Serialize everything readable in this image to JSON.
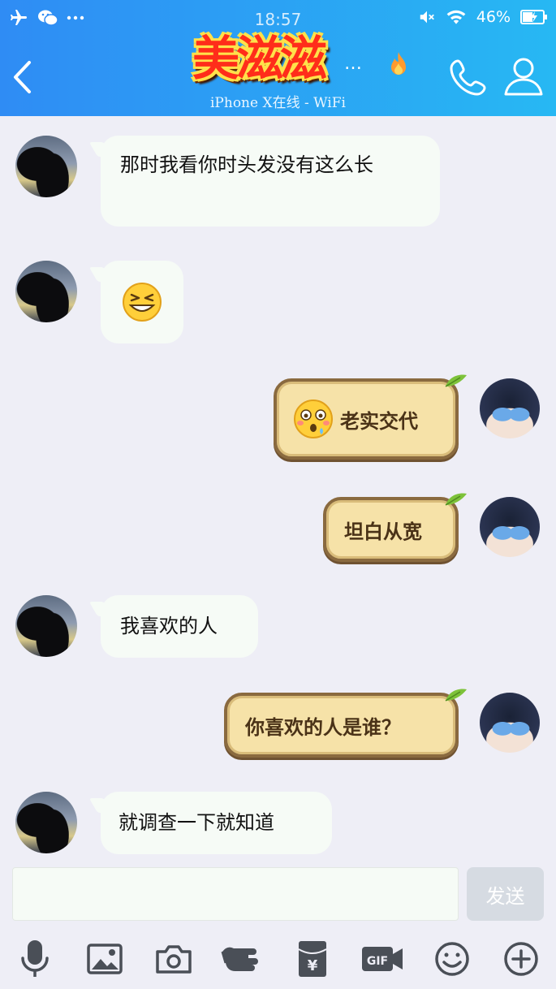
{
  "status_bar": {
    "time": "18:57",
    "battery_percent": "46%",
    "icons": [
      "airplane-icon",
      "wechat-icon",
      "more-dots-icon",
      "mute-icon",
      "wifi-icon",
      "battery-charging-icon"
    ]
  },
  "header": {
    "logo_text": "美滋滋",
    "title_ellipsis": "…",
    "subtitle": "iPhone X在线 - WiFi",
    "colors": {
      "gradient_start": "#2f8cf4",
      "gradient_end": "#27b8f3"
    }
  },
  "messages": [
    {
      "side": "them",
      "text": "那时我看你时头发没有这么长"
    },
    {
      "side": "them",
      "emoji": "grin-squint-emoji"
    },
    {
      "side": "me",
      "text": "老实交代",
      "emoji": "shocked-emoji"
    },
    {
      "side": "me",
      "text": "坦白从宽"
    },
    {
      "side": "them",
      "text": "我喜欢的人"
    },
    {
      "side": "me",
      "text": "你喜欢的人是谁？"
    },
    {
      "side": "them",
      "text": "就调查一下就知道"
    }
  ],
  "input": {
    "value": "",
    "send_label": "发送"
  },
  "toolbar": {
    "items": [
      "mic-icon",
      "image-icon",
      "camera-icon",
      "poke-icon",
      "red-packet-icon",
      "gif-icon",
      "emoji-icon",
      "plus-icon"
    ],
    "red_packet_symbol": "¥",
    "gif_label": "GIF"
  }
}
